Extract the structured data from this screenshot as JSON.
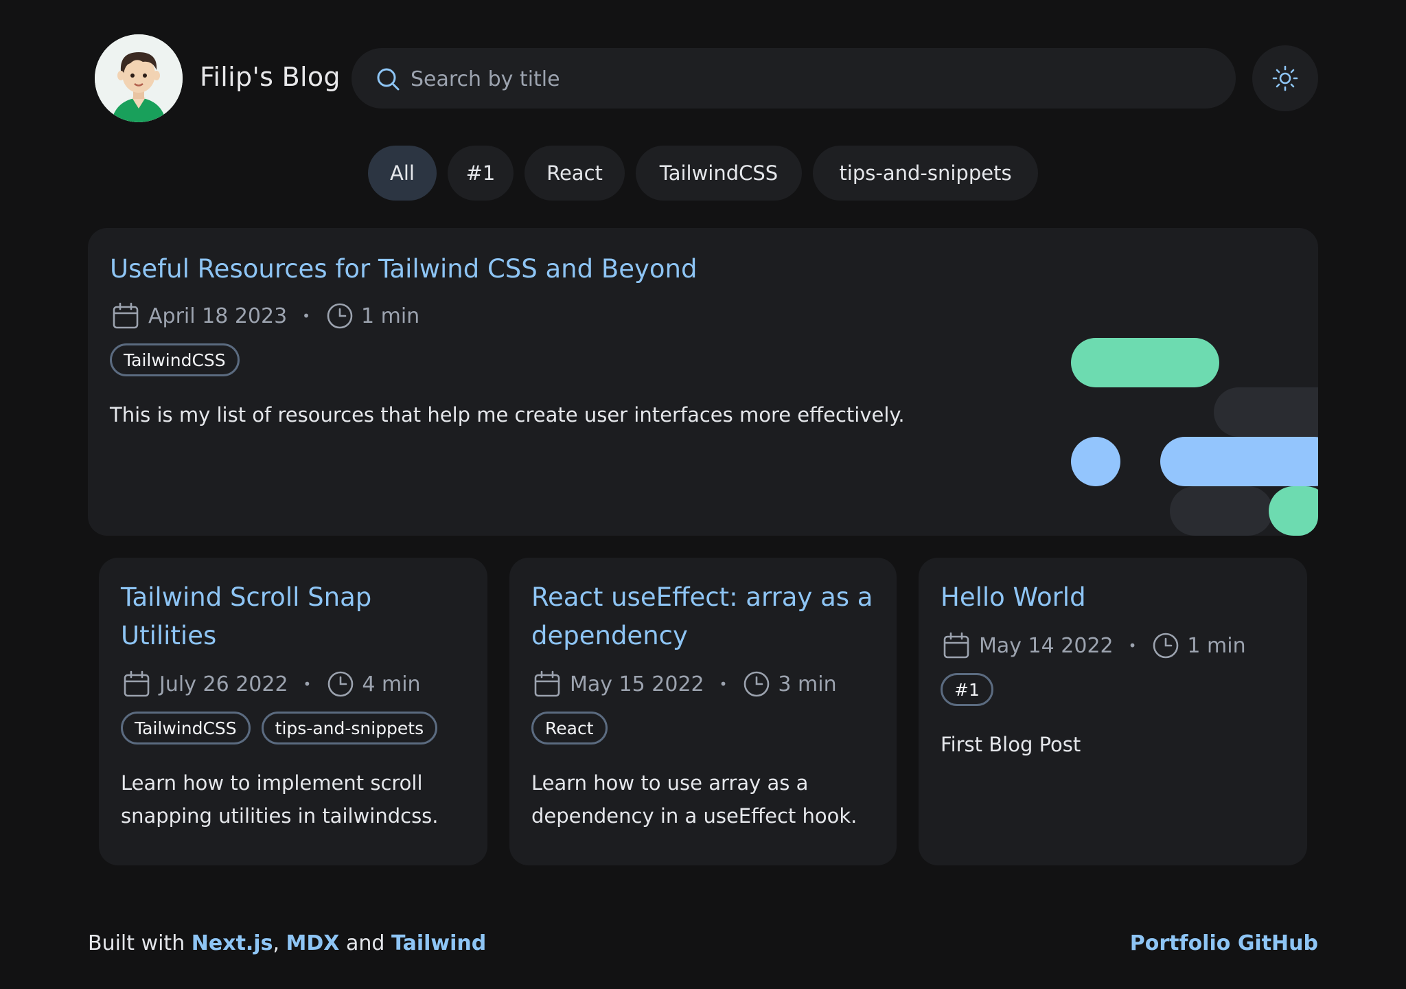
{
  "header": {
    "site_title": "Filip's Blog",
    "search_placeholder": "Search by title"
  },
  "filters": [
    "All",
    "#1",
    "React",
    "TailwindCSS",
    "tips-and-snippets"
  ],
  "featured": {
    "title": "Useful Resources for Tailwind CSS and Beyond",
    "date": "April 18 2023",
    "read_time": "1 min",
    "tags": [
      "TailwindCSS"
    ],
    "description": "This is my list of resources that help me create user interfaces more effectively."
  },
  "posts": [
    {
      "title_line1": "Tailwind Scroll Snap",
      "title_line2": "Utilities",
      "date": "July 26 2022",
      "read_time": "4 min",
      "tags": [
        "TailwindCSS",
        "tips-and-snippets"
      ],
      "desc_line1": "Learn how to implement scroll",
      "desc_line2": "snapping utilities in tailwindcss."
    },
    {
      "title_line1": "React useEffect: array as a",
      "title_line2": "dependency",
      "date": "May 15 2022",
      "read_time": "3 min",
      "tags": [
        "React"
      ],
      "desc_line1": "Learn how to use array as a",
      "desc_line2": "dependency in a useEffect hook."
    },
    {
      "title_line1": "Hello World",
      "date": "May 14 2022",
      "read_time": "1 min",
      "tags": [
        "#1"
      ],
      "desc_line1": "First Blog Post"
    }
  ],
  "footer": {
    "built_with": "Built with",
    "nextjs": "Next.js",
    "comma": ",",
    "mdx": "MDX",
    "and": "and",
    "tailwind": "Tailwind",
    "portfolio": "Portfolio",
    "github": "GitHub"
  },
  "colors": {
    "accent": "#8ec5f5",
    "mint": "#6ddbb0",
    "background": "#121213",
    "card": "#1c1d20"
  }
}
